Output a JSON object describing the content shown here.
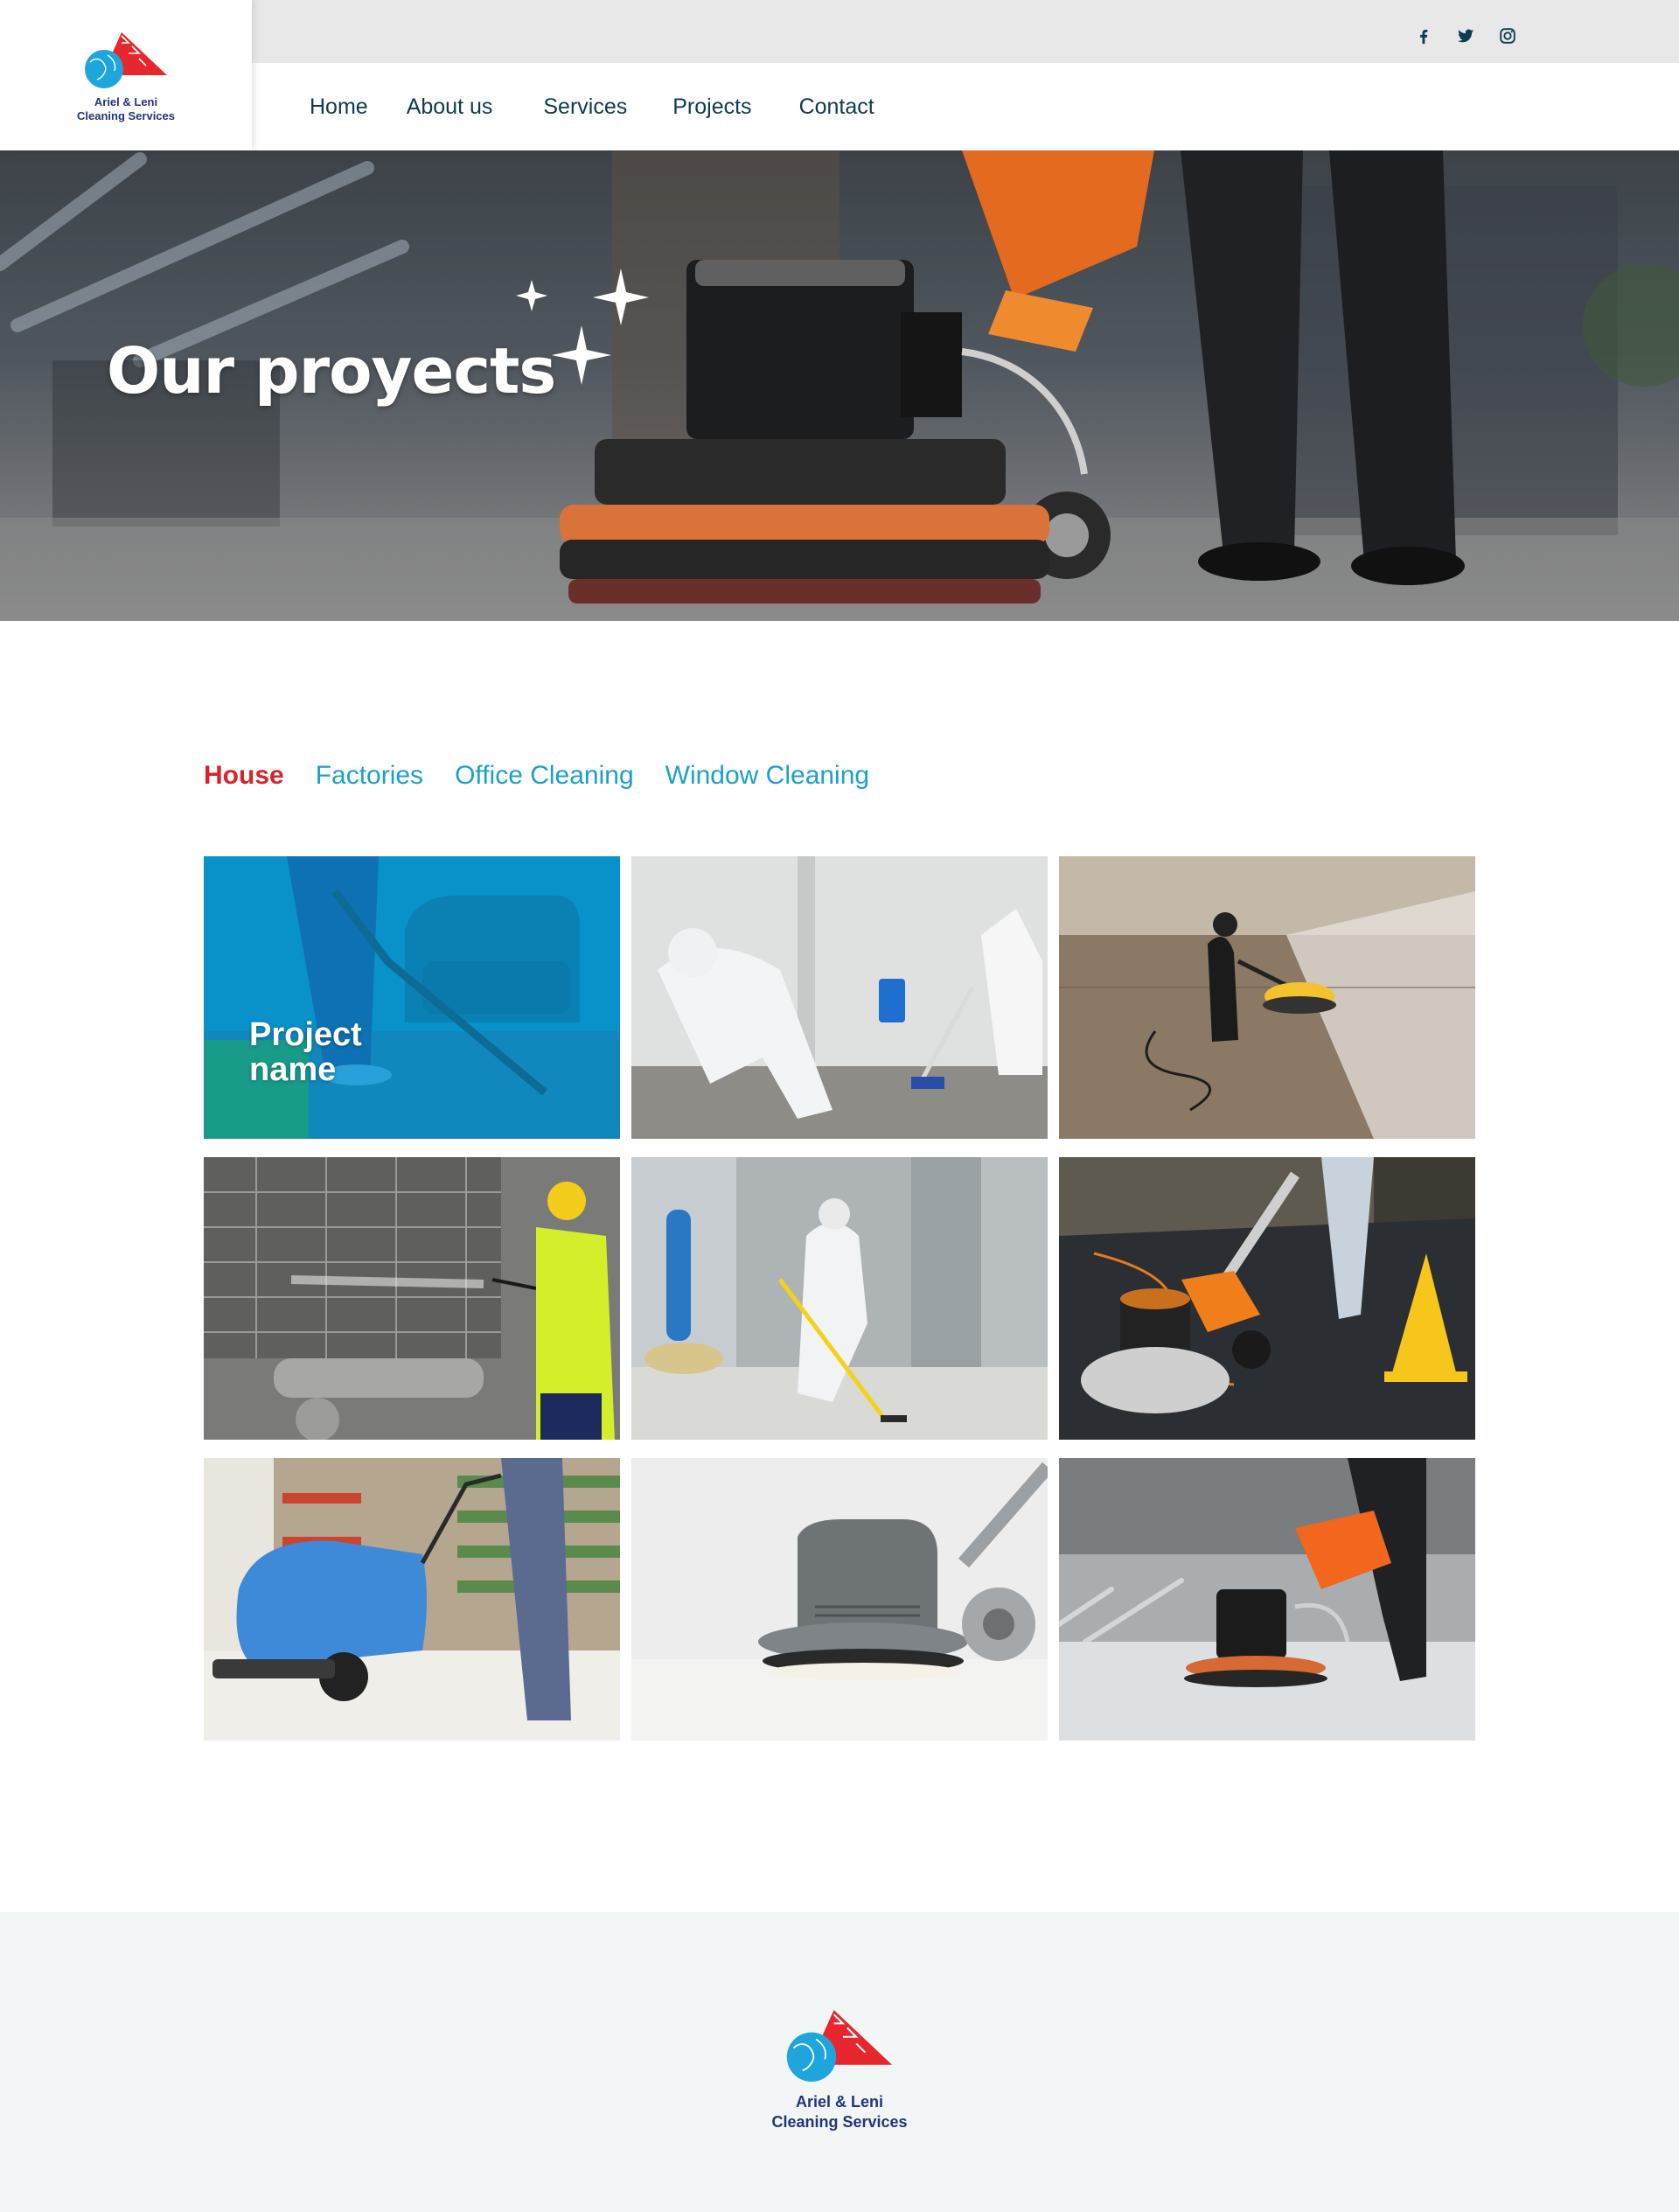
{
  "brand": {
    "name_line1": "Ariel & Leni",
    "name_line2": "Cleaning Services",
    "colors": {
      "red": "#e8262d",
      "blue": "#1ea6dc",
      "navy": "#23347a"
    }
  },
  "social": [
    "facebook-icon",
    "twitter-icon",
    "instagram-icon"
  ],
  "nav": {
    "items": [
      {
        "label": "Home"
      },
      {
        "label": "About us"
      },
      {
        "label": "Services"
      },
      {
        "label": "Projects"
      },
      {
        "label": "Contact"
      }
    ]
  },
  "hero": {
    "title": "Our proyects",
    "icon": "sparkle-icon"
  },
  "filters": {
    "active": "House",
    "tabs": [
      {
        "label": "House"
      },
      {
        "label": "Factories"
      },
      {
        "label": "Office Cleaning"
      },
      {
        "label": "Window Cleaning"
      }
    ],
    "active_color": "#d8232a",
    "tab_color": "#1da0c8"
  },
  "gallery": {
    "hover_label": "Project name",
    "tiles": [
      {
        "subject": "carpet-vacuum"
      },
      {
        "subject": "protective-suit-cleaning"
      },
      {
        "subject": "floor-polisher-sunlit"
      },
      {
        "subject": "pressure-washing"
      },
      {
        "subject": "factory-mopping"
      },
      {
        "subject": "orange-floor-machine"
      },
      {
        "subject": "supermarket-scrubber"
      },
      {
        "subject": "gray-floor-machine"
      },
      {
        "subject": "lobby-floor-machine"
      }
    ]
  }
}
